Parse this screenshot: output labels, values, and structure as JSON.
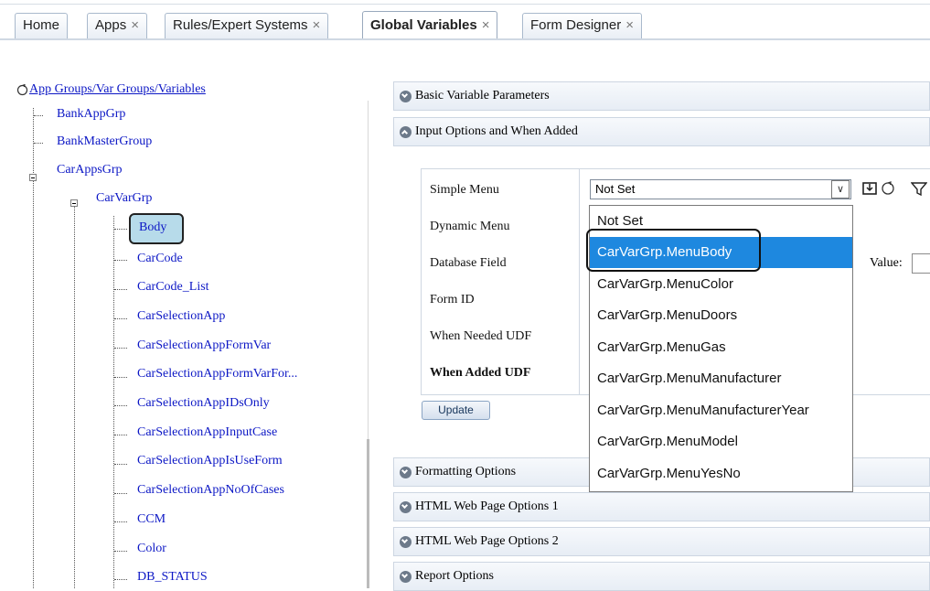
{
  "tabs": [
    {
      "label": "Home",
      "closable": false,
      "active": false
    },
    {
      "label": "Apps",
      "closable": true,
      "active": false
    },
    {
      "label": "Rules/Expert Systems",
      "closable": true,
      "active": false
    },
    {
      "label": "Global Variables",
      "closable": true,
      "active": true
    },
    {
      "label": "Form Designer",
      "closable": true,
      "active": false
    }
  ],
  "tab_close_glyph": "×",
  "tree": {
    "root_label": "App Groups/Var Groups/Variables",
    "groups": [
      "BankAppGrp",
      "BankMasterGroup",
      "CarAppsGrp"
    ],
    "subgroup": "CarVarGrp",
    "variables": [
      "Body",
      "CarCode",
      "CarCode_List",
      "CarSelectionApp",
      "CarSelectionAppFormVar",
      "CarSelectionAppFormVarFor...",
      "CarSelectionAppIDsOnly",
      "CarSelectionAppInputCase",
      "CarSelectionAppIsUseForm",
      "CarSelectionAppNoOfCases",
      "CCM",
      "Color",
      "DB_STATUS"
    ],
    "selected": "Body"
  },
  "sections": {
    "basic": "Basic Variable Parameters",
    "input": "Input Options and When Added",
    "formatting": "Formatting Options",
    "html1": "HTML Web Page Options 1",
    "html2": "HTML Web Page Options 2",
    "report": "Report Options"
  },
  "form": {
    "simple_menu_label": "Simple Menu",
    "dynamic_menu_label": "Dynamic Menu",
    "database_field_label": "Database Field",
    "form_id_label": "Form ID",
    "when_needed_label": "When Needed UDF",
    "when_added_label": "When Added UDF",
    "simple_menu_value": "Not Set",
    "value_label": "Value:",
    "update_button": "Update"
  },
  "dropdown": {
    "options": [
      "Not Set",
      "CarVarGrp.MenuBody",
      "CarVarGrp.MenuColor",
      "CarVarGrp.MenuDoors",
      "CarVarGrp.MenuGas",
      "CarVarGrp.MenuManufacturer",
      "CarVarGrp.MenuManufacturerYear",
      "CarVarGrp.MenuModel",
      "CarVarGrp.MenuYesNo"
    ],
    "highlighted": "CarVarGrp.MenuBody"
  },
  "colors": {
    "link": "#0c17c5",
    "highlight": "#1e88df",
    "selected_node_bg": "#b7dbea"
  }
}
